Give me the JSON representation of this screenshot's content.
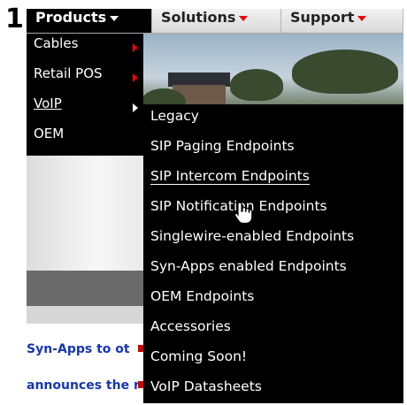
{
  "step_number": "1",
  "navbar": {
    "items": [
      {
        "label": "Products",
        "active": true
      },
      {
        "label": "Solutions",
        "active": false
      },
      {
        "label": "Support",
        "active": false
      }
    ]
  },
  "products_menu": {
    "items": [
      {
        "label": "Cables",
        "has_submenu": true
      },
      {
        "label": "Retail POS",
        "has_submenu": true
      },
      {
        "label": "VoIP",
        "has_submenu": true,
        "active": true
      },
      {
        "label": "OEM",
        "has_submenu": false
      }
    ]
  },
  "voip_submenu": {
    "items": [
      "Legacy",
      "SIP Paging Endpoints",
      "SIP Intercom Endpoints",
      "SIP Notification Endpoints",
      "Singlewire-enabled Endpoints",
      "Syn-Apps enabled Endpoints",
      "OEM Endpoints",
      "Accessories",
      "Coming Soon!",
      "VoIP Datasheets"
    ],
    "hovered_index": 2
  },
  "background_text": {
    "line1": "Syn-Apps to ot",
    "line2": "announces the r"
  },
  "colors": {
    "menu_bg": "#000000",
    "caret_red": "#e00000",
    "link_blue": "#1736b3"
  }
}
